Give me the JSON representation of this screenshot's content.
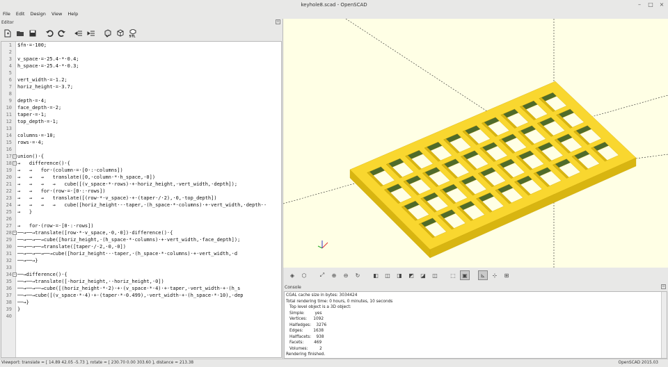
{
  "window": {
    "title": "keyhole8.scad - OpenSCAD",
    "controls": [
      "–",
      "□",
      "×"
    ]
  },
  "menu": [
    "File",
    "Edit",
    "Design",
    "View",
    "Help"
  ],
  "editor": {
    "label": "Editor",
    "lines": [
      "$fn·=·100;",
      "",
      "v_space·=·25.4·*·0.4;",
      "h_space·=·25.4·*·0.3;",
      "",
      "vert_width·=·1.2;",
      "horiz_height·=·3.7;",
      "",
      "depth·=·4;",
      "face_depth·=·2;",
      "taper·=·1;",
      "top_depth·=·1;",
      "",
      "columns·=·10;",
      "rows·=·4;",
      "",
      "union()·{",
      "→   difference()·{",
      "→   →   for·(column·=·[0·:·columns])",
      "→   →   →   translate([0,·column·*·h_space,·0])",
      "→   →   →   →   cube([(v_space·*·rows)·+·horiz_height,·vert_width,·depth]);",
      "→   →   for·(row·=·[0·:·rows])",
      "→   →   →   translate([(row·*·v_space)·+·(taper·/·2),·0,·top_depth])",
      "→   →   →   →   cube([horiz_height·-·taper,·(h_space·*·columns)·+·vert_width,·depth·-",
      "→   }",
      "",
      "→   for·(row·=·[0·:·rows])",
      "──→──→translate([row·*·v_space,·0,·0])·difference()·{",
      "──→──→──→cube([horiz_height,·(h_space·*·columns)·+·vert_width,·face_depth]);",
      "──→──→──→translate([taper·/·2,·0,·0])",
      "──→──→──→──→cube([horiz_height·-·taper,·(h_space·*·columns)·+·vert_width,·d",
      "──→──→}",
      "",
      "──→difference()·{",
      "──→──→translate([-horiz_height,·-horiz_height,·0])",
      "──→──→──→cube([(horiz_height·*·2)·+·(v_space·*·4)·+·taper,·vert_width·+·(h_s",
      "──→──→cube([(v_space·*·4)·+·(taper·*·0.499),·vert_width·+·(h_space·*·10),·dep",
      "──→}",
      "}",
      ""
    ]
  },
  "console": {
    "label": "Console",
    "lines": [
      "CGAL cache size in bytes: 3034424",
      "Total rendering time: 0 hours, 0 minutes, 10 seconds",
      "Top level object is a 3D object:",
      "Simple:        yes",
      "Vertices:     1092",
      "Halfedges:    3276",
      "Edges:        1638",
      "Halffacets:    938",
      "Facets:        469",
      "Volumes:         2",
      "Rendering finished."
    ]
  },
  "status": {
    "viewport": "Viewport: translate = [ 14.89 42.05 -5.73 ], rotate = [ 230.70 0.00 303.60 ], distance = 213.38",
    "version": "OpenSCAD 2015.03"
  },
  "colors": {
    "model": "#f9d72f",
    "model_dark": "#d8b511",
    "inner": "#4f6b2a",
    "viewport_bg": "#ffffe5"
  },
  "toolbar_icons": [
    "new-file-icon",
    "open-file-icon",
    "save-file-icon",
    "undo-icon",
    "redo-icon",
    "unindent-icon",
    "indent-icon",
    "preview-icon",
    "render-icon",
    "export-stl-icon"
  ],
  "view_icons": [
    "preview-view-icon",
    "render-view-icon",
    "zoom-all-icon",
    "zoom-in-icon",
    "zoom-out-icon",
    "reset-view-icon",
    "view-right-icon",
    "view-top-icon",
    "view-bottom-icon",
    "view-left-icon",
    "view-front-icon",
    "view-back-icon",
    "perspective-icon",
    "orthogonal-icon",
    "show-axes-icon",
    "show-scale-icon",
    "show-edges-icon"
  ]
}
